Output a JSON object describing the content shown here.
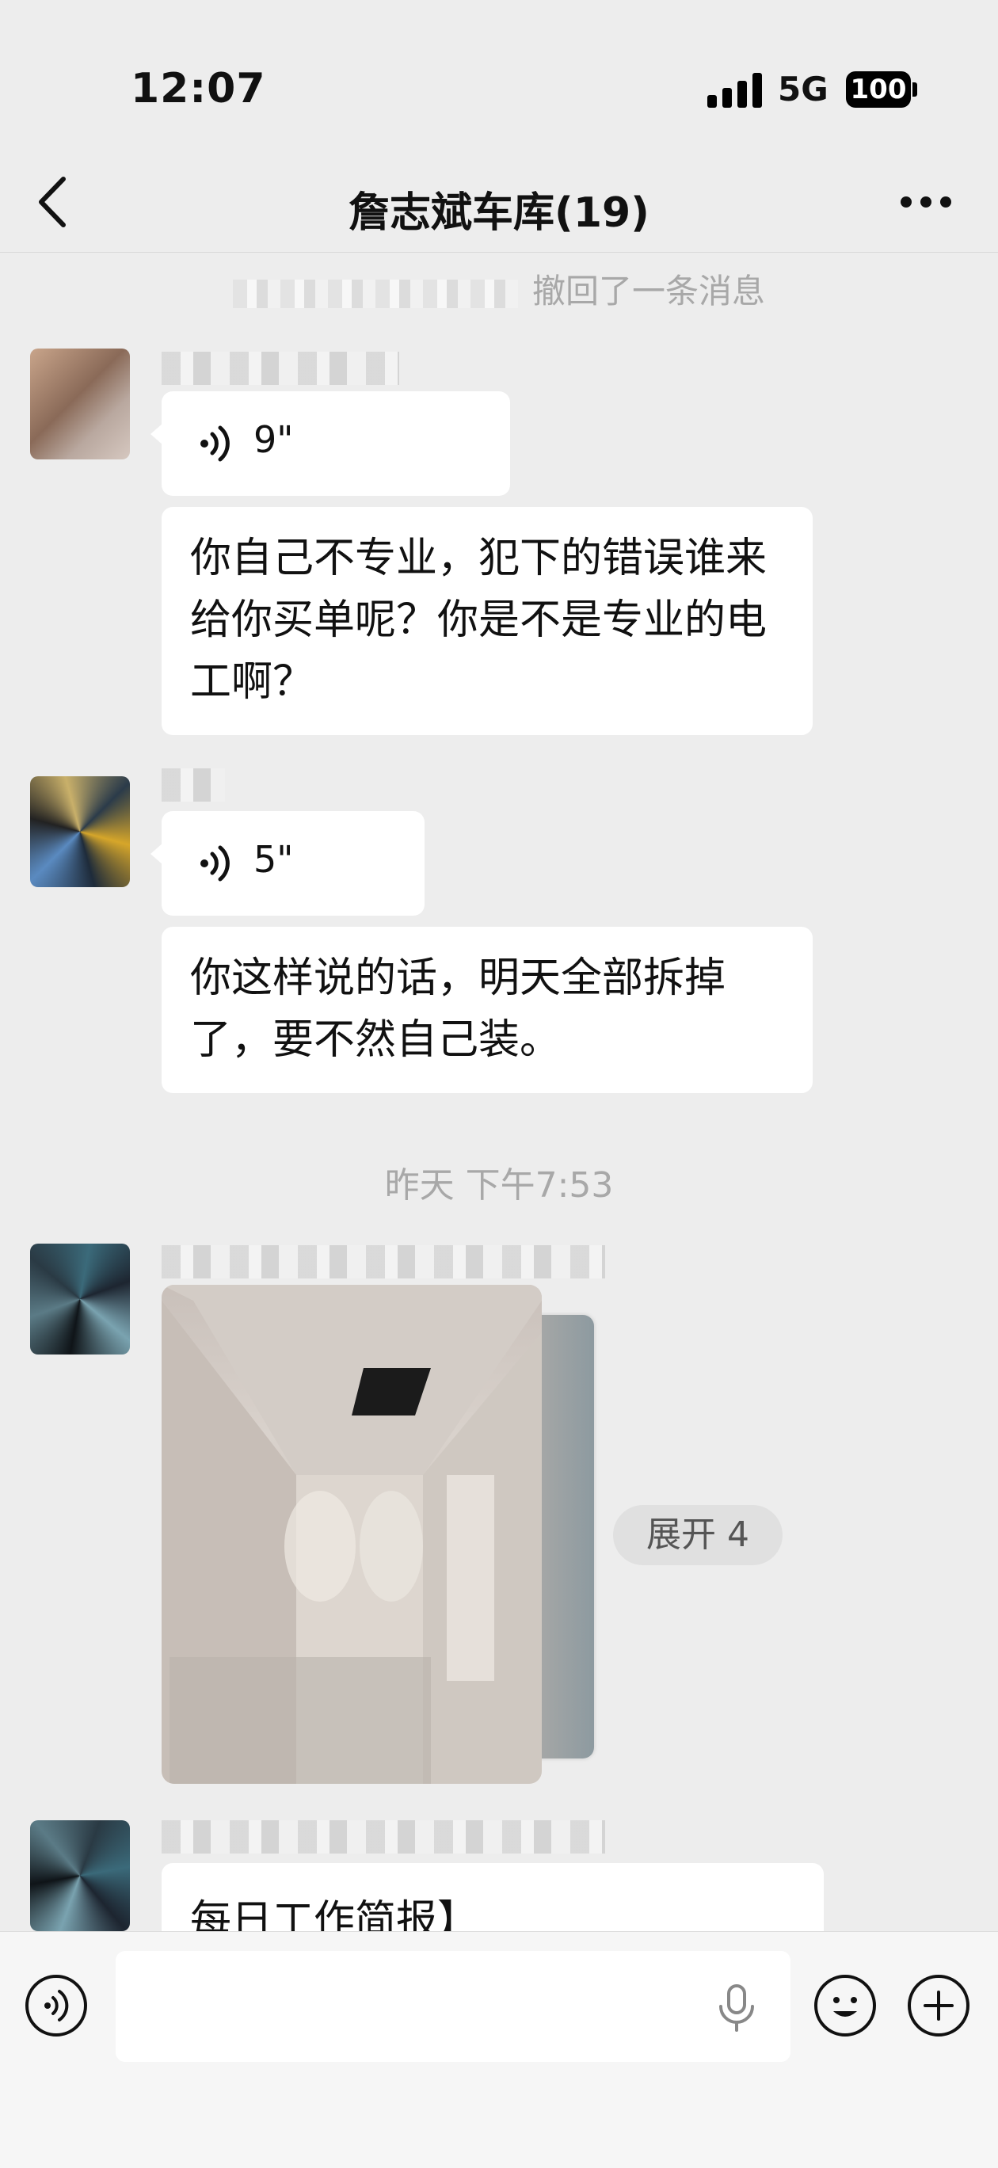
{
  "status_bar": {
    "time": "12:07",
    "network": "5G",
    "battery": "100"
  },
  "header": {
    "title": "詹志斌车库(19)"
  },
  "messages": {
    "recall_notice": "撤回了一条消息",
    "voice1": {
      "duration": "9\""
    },
    "text1": "你自己不专业，犯下的错误谁来给你买单呢？你是不是专业的电工啊？",
    "voice2": {
      "duration": "5\""
    },
    "text2": "你这样说的话，明天全部拆掉了，要不然自己装。",
    "timestamp": "昨天 下午7:53",
    "expand_label": "展开 4",
    "text3": "每日工作简报】"
  },
  "icons": {
    "back": "chevron-left-icon",
    "more": "more-dots-icon",
    "voice": "voice-wave-icon",
    "mic": "microphone-icon",
    "emoji": "emoji-icon",
    "plus": "plus-icon"
  },
  "colors": {
    "background": "#ededed",
    "bubble": "#ffffff",
    "muted_text": "#a8a8a8"
  }
}
